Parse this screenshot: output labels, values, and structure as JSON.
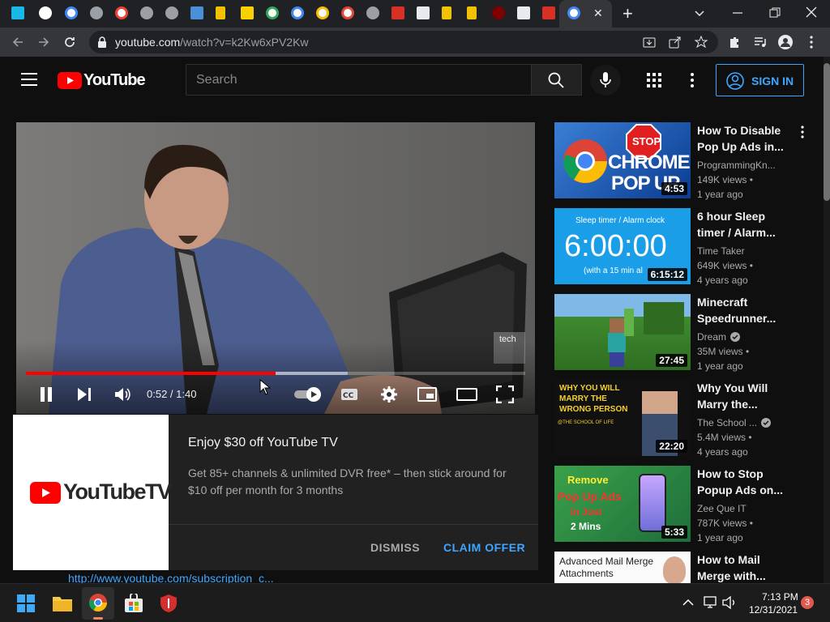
{
  "browser": {
    "url_host": "youtube.com",
    "url_path": "/watch?v=k2Kw6xPV2Kw",
    "tab_glyphs": {
      "close": "✕",
      "new": "+"
    }
  },
  "header": {
    "logo_text": "YouTube",
    "search_placeholder": "Search",
    "signin_label": "SIGN IN"
  },
  "player": {
    "time": "0:52 / 1:40",
    "progress": 0.5,
    "buffered": 0.645,
    "watermark": "tech"
  },
  "ad": {
    "logo_text": "YouTubeTV",
    "title": "Enjoy $30 off YouTube TV",
    "body": "Get 85+ channels & unlimited DVR free* – then stick around for $10 off per month for 3 months",
    "dismiss_label": "DISMISS",
    "claim_label": "CLAIM OFFER",
    "link_text": "http://www.youtube.com/subscription_c..."
  },
  "recommendations": [
    {
      "title": "How To Disable Pop Up Ads in...",
      "channel": "ProgrammingKn...",
      "views": "149K views •",
      "age": "1 year ago",
      "duration": "4:53",
      "thumb_text_1": "CHROME",
      "thumb_text_2": "POP UP",
      "thumb_sign": "STOP"
    },
    {
      "title": "6 hour Sleep timer / Alarm...",
      "channel": "Time Taker",
      "views": "649K views •",
      "age": "4 years ago",
      "duration": "6:15:12",
      "thumb_text_1": "Sleep timer / Alarm clock",
      "thumb_text_2": "6:00:00",
      "thumb_text_3": "(with a 15 min al"
    },
    {
      "title": "Minecraft Speedrunner...",
      "channel": "Dream",
      "views": "35M views •",
      "age": "1 year ago",
      "duration": "27:45"
    },
    {
      "title": "Why You Will Marry the...",
      "channel": "The School ...",
      "views": "5.4M views •",
      "age": "4 years ago",
      "duration": "22:20",
      "thumb_text_1": "WHY YOU WILL MARRY THE WRONG PERSON",
      "thumb_text_2": "@THE SCHOOL OF LIFE"
    },
    {
      "title": "How to Stop Popup Ads on...",
      "channel": "Zee Que IT",
      "views": "787K views •",
      "age": "1 year ago",
      "duration": "5:33",
      "thumb_text_1": "Remove",
      "thumb_text_2": "Pop Up Ads",
      "thumb_text_3": "in Just",
      "thumb_text_4": "2 Mins"
    },
    {
      "title": "How to Mail Merge with...",
      "thumb_text_1": "Advanced Mail Merge",
      "thumb_text_2": "Attachments"
    }
  ],
  "taskbar": {
    "time": "7:13 PM",
    "date": "12/31/2021",
    "notification_count": "3"
  },
  "colors": {
    "youtube_red": "#ff0000",
    "accent_blue": "#3ea6ff",
    "progress_red": "#ff0000"
  }
}
